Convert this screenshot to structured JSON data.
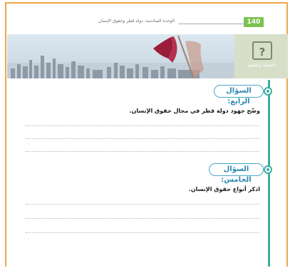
{
  "header": {
    "page_number": "140",
    "unit_title": "الوحدة السادسة: دولة قطر وحقوق الإنسان"
  },
  "banner": {
    "icon_symbol": "?",
    "caption": "النشاط والتقييم"
  },
  "questions": [
    {
      "label": "السؤال الرابع:",
      "text": "وضّح جهود دولة قطر في مجال حقوق الإنسان."
    },
    {
      "label": "السؤال الخامس:",
      "text": "اذكر أنواع حقوق الإنسان."
    }
  ],
  "colors": {
    "frame": "#f0a64a",
    "page_badge": "#7cc24f",
    "timeline": "#3aaea0",
    "question_pill": "#4aa7c9"
  }
}
